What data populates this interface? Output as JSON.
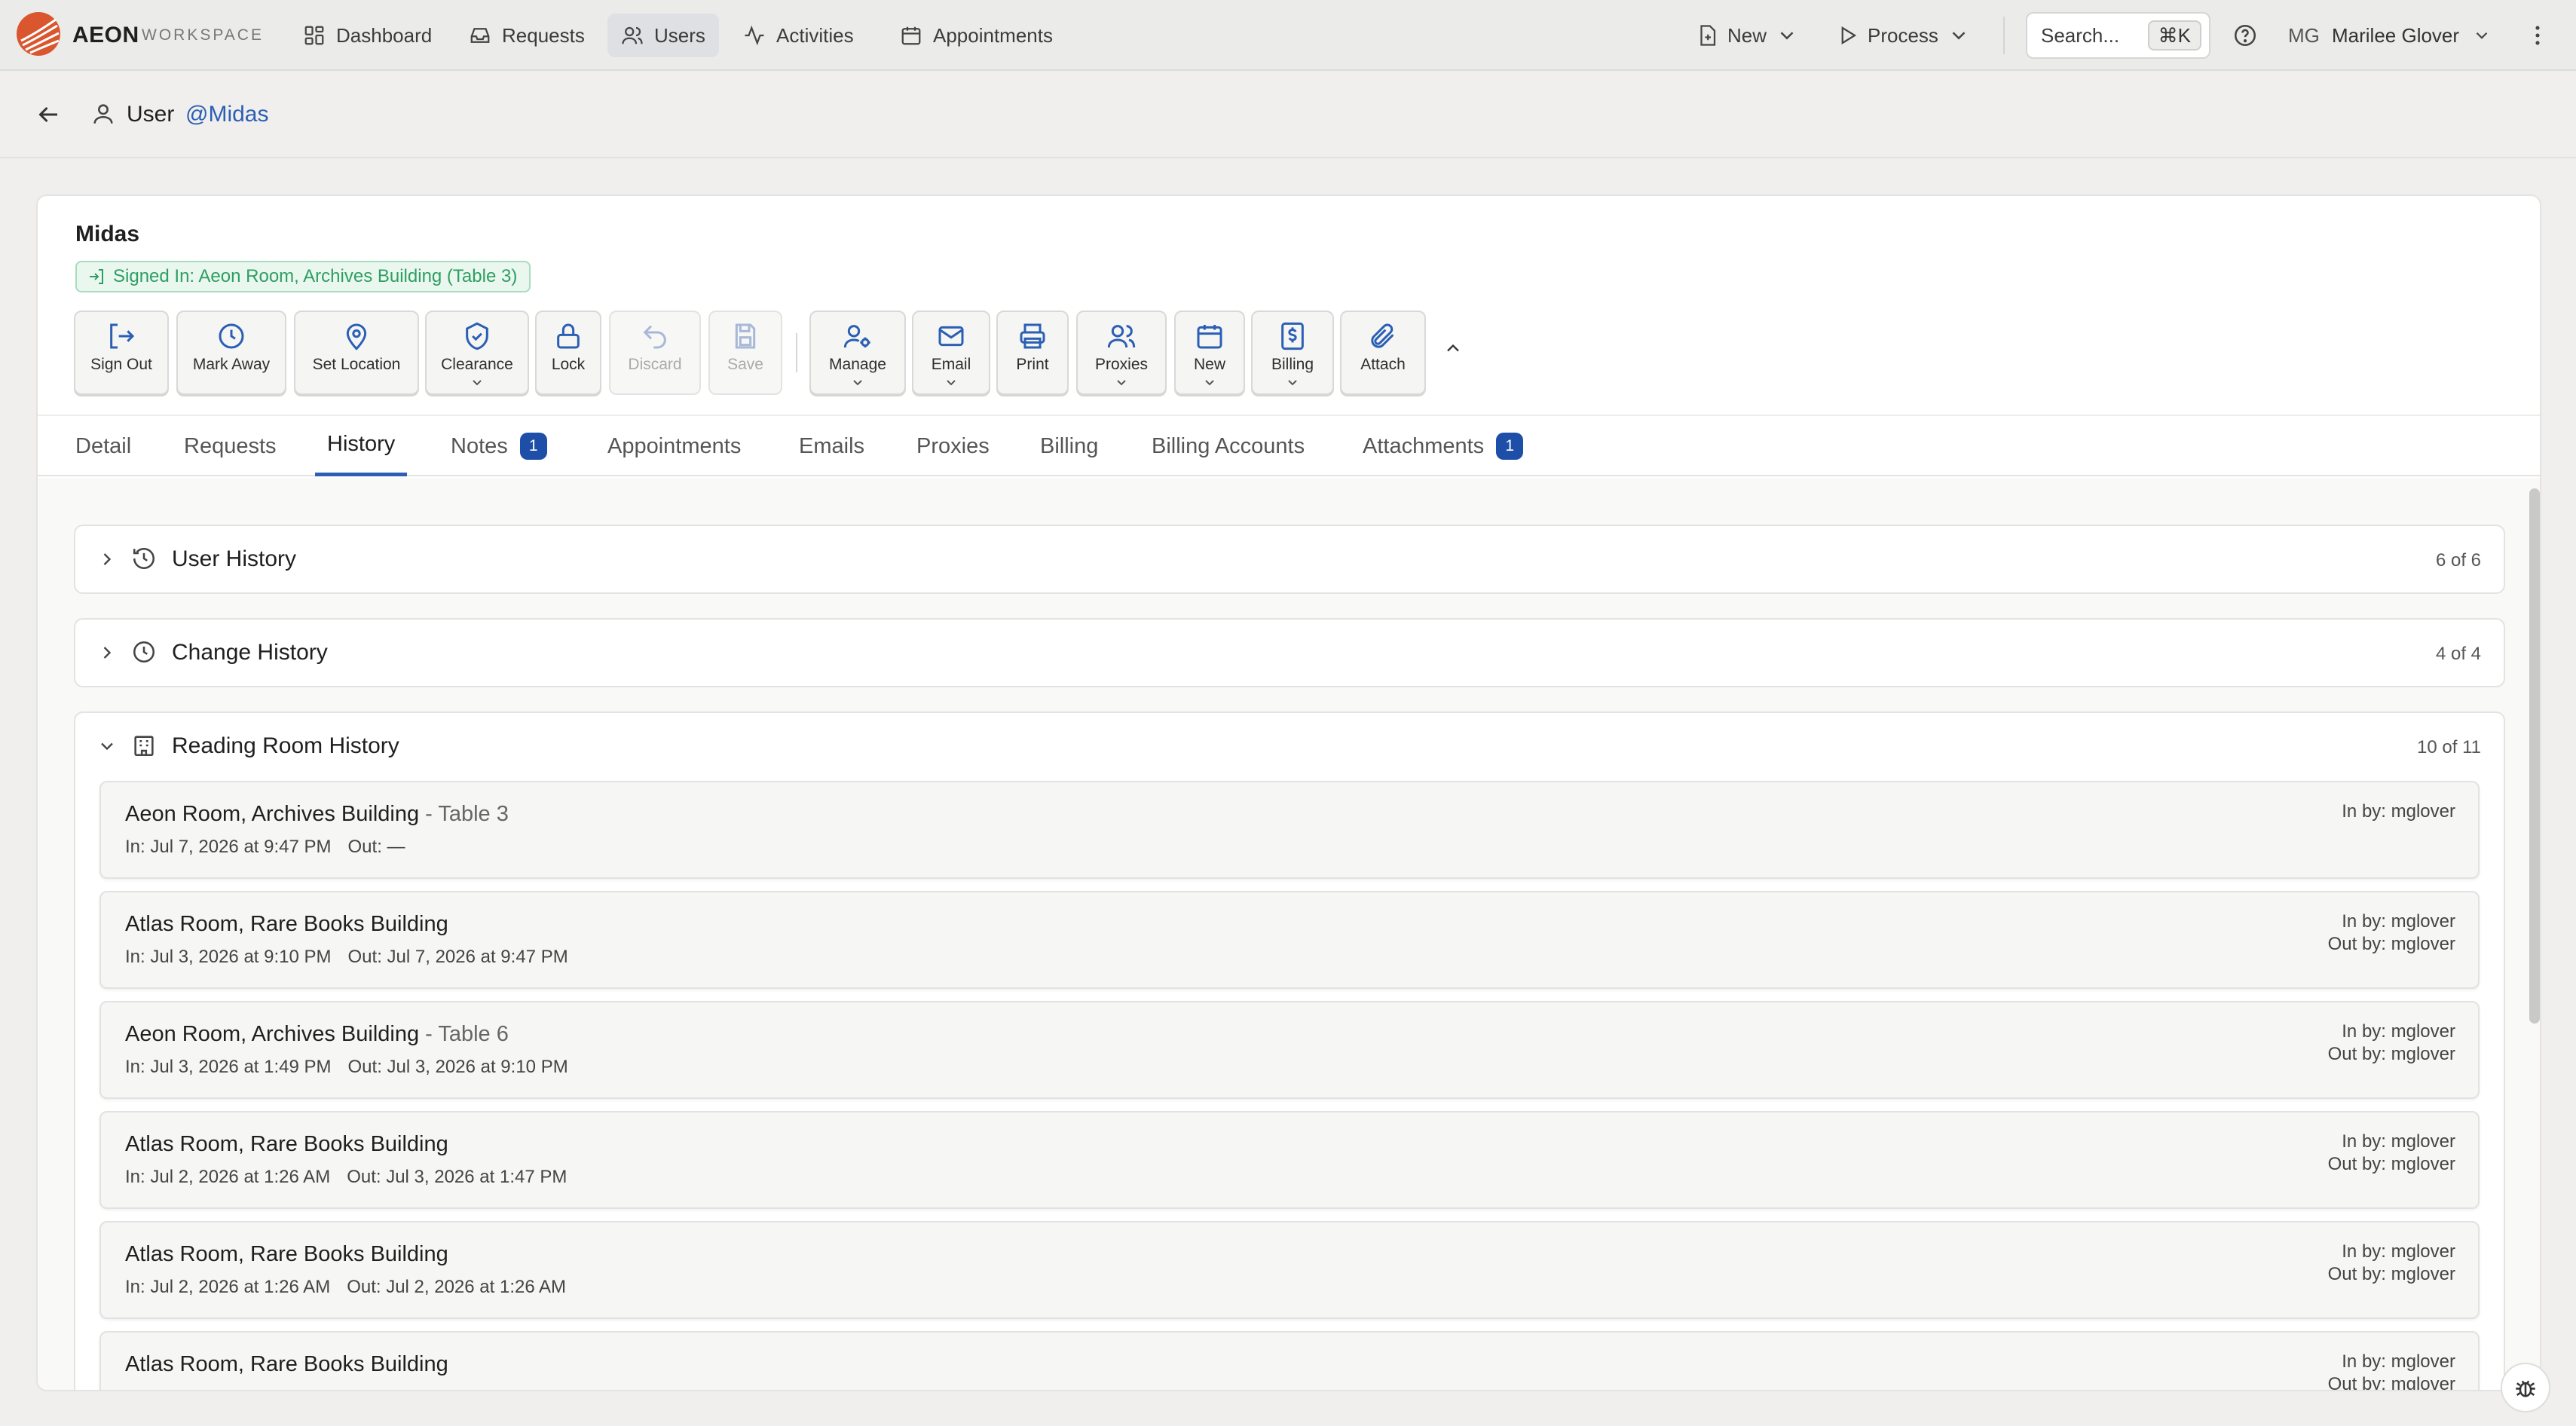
{
  "app": {
    "brand": "AEON",
    "brand_sub": "WORKSPACE"
  },
  "nav": {
    "items": [
      {
        "label": "Dashboard",
        "icon": "dashboard-icon"
      },
      {
        "label": "Requests",
        "icon": "inbox-icon"
      },
      {
        "label": "Users",
        "icon": "users-icon",
        "active": true
      },
      {
        "label": "Activities",
        "icon": "activity-icon"
      },
      {
        "label": "Appointments",
        "icon": "calendar-icon"
      }
    ],
    "new_label": "New",
    "process_label": "Process",
    "search_placeholder": "Search...",
    "search_shortcut": "⌘K",
    "user_initials": "MG",
    "user_name": "Marilee Glover"
  },
  "breadcrumb": {
    "type_label": "User",
    "handle": "@Midas"
  },
  "record": {
    "title": "Midas",
    "signed_in": "Signed In: Aeon Room, Archives Building (Table 3)"
  },
  "toolbar": {
    "sign_out": "Sign Out",
    "mark_away": "Mark Away",
    "set_location": "Set Location",
    "clearance": "Clearance",
    "lock": "Lock",
    "discard": "Discard",
    "save": "Save",
    "manage": "Manage",
    "email": "Email",
    "print": "Print",
    "proxies": "Proxies",
    "new": "New",
    "billing": "Billing",
    "attach": "Attach"
  },
  "tabs": [
    {
      "label": "Detail"
    },
    {
      "label": "Requests"
    },
    {
      "label": "History",
      "active": true
    },
    {
      "label": "Notes",
      "badge": "1"
    },
    {
      "label": "Appointments"
    },
    {
      "label": "Emails"
    },
    {
      "label": "Proxies"
    },
    {
      "label": "Billing"
    },
    {
      "label": "Billing Accounts"
    },
    {
      "label": "Attachments",
      "badge": "1"
    }
  ],
  "sections": {
    "user_history": {
      "title": "User History",
      "count": "6 of 6"
    },
    "change_history": {
      "title": "Change History",
      "count": "4 of 4"
    },
    "reading_room": {
      "title": "Reading Room History",
      "count": "10 of 11"
    }
  },
  "reading_room_entries": [
    {
      "place": "Aeon Room, Archives Building",
      "table": " - Table 3",
      "in": "In: Jul 7, 2026 at 9:47 PM",
      "out": "Out: —",
      "in_by": "In by: mglover",
      "out_by": ""
    },
    {
      "place": "Atlas Room, Rare Books Building",
      "table": "",
      "in": "In: Jul 3, 2026 at 9:10 PM",
      "out": "Out: Jul 7, 2026 at 9:47 PM",
      "in_by": "In by: mglover",
      "out_by": "Out by: mglover"
    },
    {
      "place": "Aeon Room, Archives Building",
      "table": " - Table 6",
      "in": "In: Jul 3, 2026 at 1:49 PM",
      "out": "Out: Jul 3, 2026 at 9:10 PM",
      "in_by": "In by: mglover",
      "out_by": "Out by: mglover"
    },
    {
      "place": "Atlas Room, Rare Books Building",
      "table": "",
      "in": "In: Jul 2, 2026 at 1:26 AM",
      "out": "Out: Jul 3, 2026 at 1:47 PM",
      "in_by": "In by: mglover",
      "out_by": "Out by: mglover"
    },
    {
      "place": "Atlas Room, Rare Books Building",
      "table": "",
      "in": "In: Jul 2, 2026 at 1:26 AM",
      "out": "Out: Jul 2, 2026 at 1:26 AM",
      "in_by": "In by: mglover",
      "out_by": "Out by: mglover"
    },
    {
      "place": "Atlas Room, Rare Books Building",
      "table": "",
      "in": "",
      "out": "",
      "in_by": "In by: mglover",
      "out_by": "Out by: mglover"
    }
  ],
  "colors": {
    "accent": "#2b5fb4",
    "badge": "#1e4fa8",
    "success": "#2e9e62",
    "logo": "#d9562f"
  }
}
